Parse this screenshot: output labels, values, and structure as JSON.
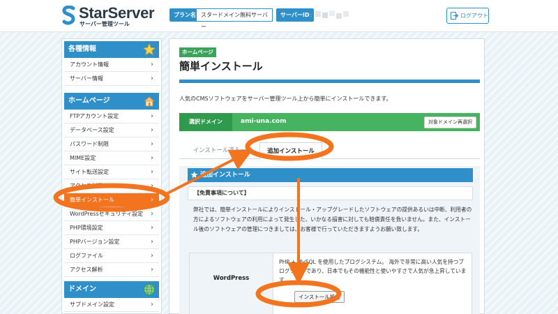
{
  "header": {
    "logo_title": "StarServer",
    "logo_subtitle": "サーバー管理ツール",
    "plan_label": "プラン名",
    "plan_value": "スタードメイン無料サーバー",
    "server_id_label": "サーバーID",
    "server_id_value": ":",
    "logout_label": "ログアウト"
  },
  "sidebar": {
    "sections": [
      {
        "title": "各種情報",
        "icon": "star-icon",
        "items": [
          "アカウント情報",
          "サーバー情報"
        ]
      },
      {
        "title": "ホームページ",
        "icon": "house-icon",
        "items": [
          "FTPアカウント設定",
          "データベース設定",
          "パスワード制限",
          "MIME設定",
          "サイト転送設定",
          "アクセス制限",
          "簡単インストール",
          "WordPressセキュリティ設定",
          "PHP環境設定",
          "PHPバージョン設定",
          "ログファイル",
          "アクセス解析"
        ]
      },
      {
        "title": "ドメイン",
        "icon": "globe-icon",
        "items": [
          "サブドメイン設定"
        ]
      }
    ],
    "active_item": "簡単インストール"
  },
  "main": {
    "page_tag": "ホームページ",
    "page_title": "簡単インストール",
    "intro": "人気のCMSソフトウェアをサーバー管理ツール上から簡単にインストールできます。",
    "domain_label": "選択ドメイン",
    "domain_value": "ami-una.com",
    "domain_reselect_button": "対象ドメイン再選択",
    "tabs": [
      "インストール済み一覧",
      "追加インストール"
    ],
    "active_tab": "追加インストール",
    "sub_heading": "追加インストール",
    "disclaimer_title": "【免責事項について】",
    "disclaimer_text": "弊社では、簡単インストールによりインストール・アップグレードしたソフトウェアの提供あるいは中断、利用者の方によるソフトウェアの利用によって発生した、いかなる損害に対しても賠償責任を負いません。また、インストール後のソフトウェアの管理につきましては、お客様で行っていただきますようお願い致します。",
    "app_name": "WordPress",
    "app_description": "PHP + MySQL を使用したブログシステム。 海外で非常に高い人気を持つブログツールであり、日本でもその機能性と使いやすさで人気が急上昇しています。",
    "install_button": "インストール設定"
  },
  "colors": {
    "accent_blue": "#2f8fc9",
    "annotation_orange": "#f3741f",
    "domain_green": "#45b35f",
    "page_tag_green": "#3aa55a"
  }
}
